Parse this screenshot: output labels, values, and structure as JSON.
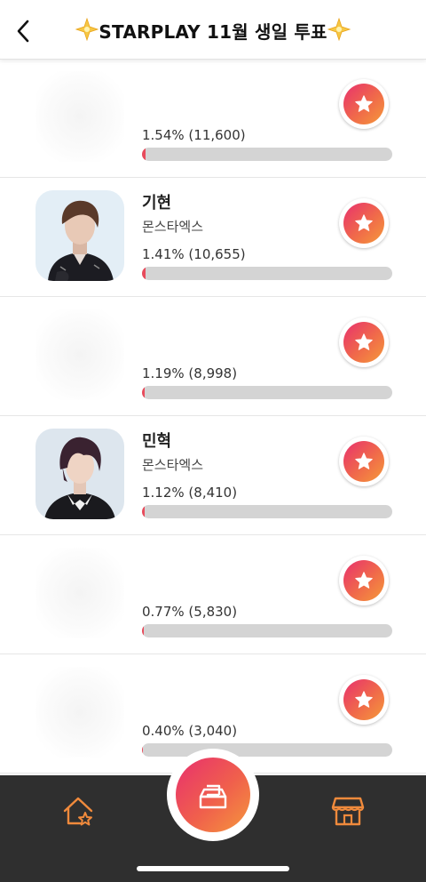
{
  "header": {
    "title": "STARPLAY 11월 생일 투표",
    "back_icon": "chevron-left-icon",
    "sparkle_icon": "sparkle-star-icon"
  },
  "colors": {
    "accent_start": "#e8306e",
    "accent_end": "#f59a3a",
    "bar_fill": "#e84b5c",
    "bar_track": "#d4d4d4",
    "bottom_bar": "#2f2f2f"
  },
  "candidates": [
    {
      "name": "",
      "group": "",
      "percent_text": "1.54% (11,600)",
      "percent": 1.54,
      "votes": "11,600",
      "photo": "hidden"
    },
    {
      "name": "기현",
      "group": "몬스타엑스",
      "percent_text": "1.41% (10,655)",
      "percent": 1.41,
      "votes": "10,655",
      "photo": "visible"
    },
    {
      "name": "",
      "group": "",
      "percent_text": "1.19% (8,998)",
      "percent": 1.19,
      "votes": "8,998",
      "photo": "hidden"
    },
    {
      "name": "민혁",
      "group": "몬스타엑스",
      "percent_text": "1.12% (8,410)",
      "percent": 1.12,
      "votes": "8,410",
      "photo": "visible"
    },
    {
      "name": "",
      "group": "",
      "percent_text": "0.77% (5,830)",
      "percent": 0.77,
      "votes": "5,830",
      "photo": "hidden"
    },
    {
      "name": "",
      "group": "",
      "percent_text": "0.40% (3,040)",
      "percent": 0.4,
      "votes": "3,040",
      "photo": "hidden"
    }
  ],
  "bottom_nav": {
    "left_icon": "home-star-icon",
    "center_icon": "ballot-box-icon",
    "right_icon": "store-icon"
  }
}
